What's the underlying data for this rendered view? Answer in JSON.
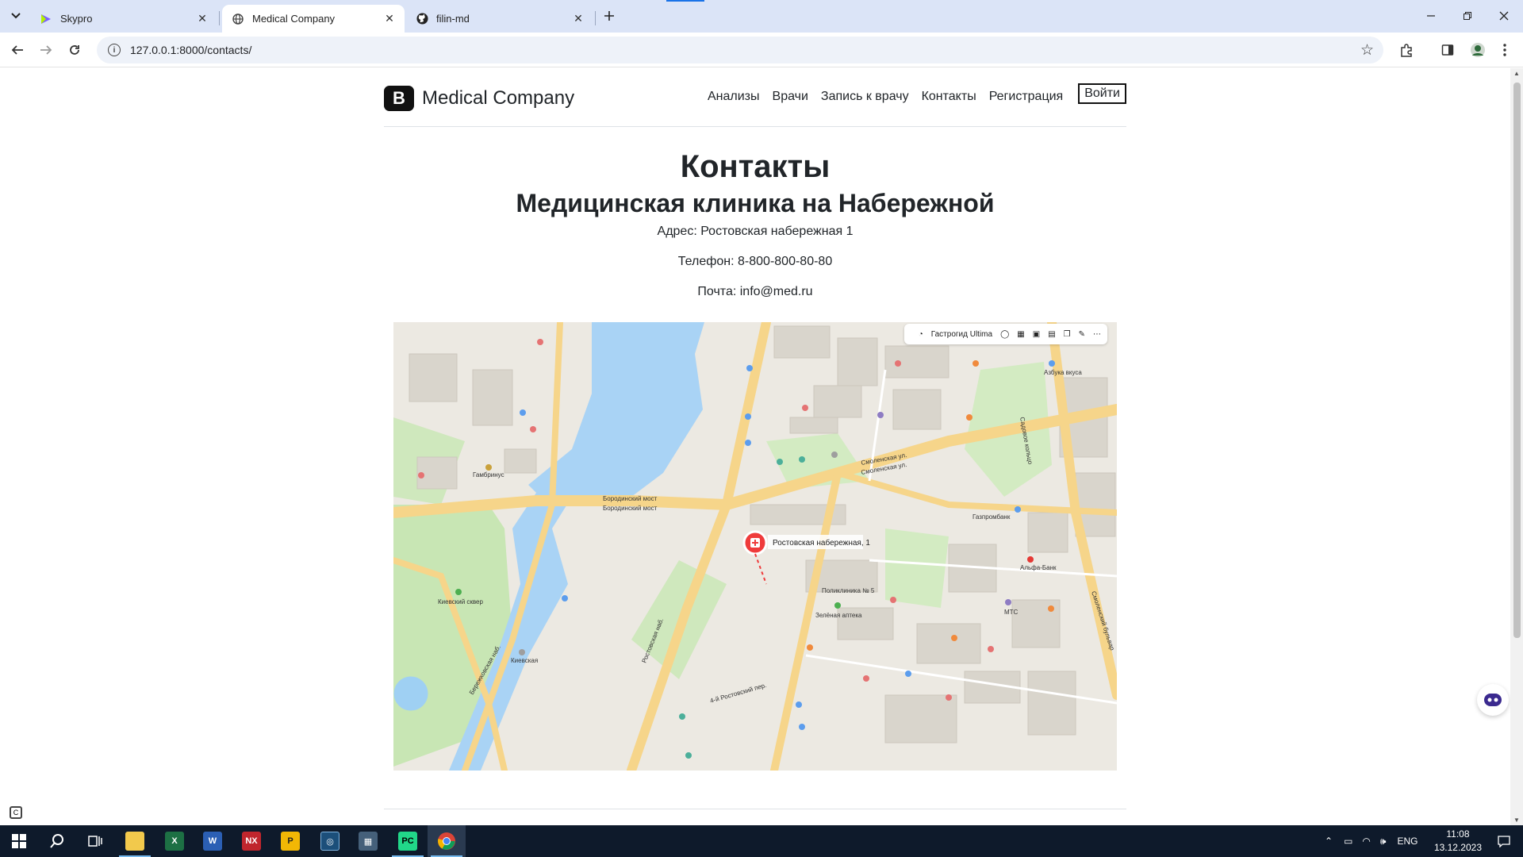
{
  "browser": {
    "tabs": [
      {
        "title": "Skypro",
        "active": false
      },
      {
        "title": "Medical Company",
        "active": true
      },
      {
        "title": "filin-md",
        "active": false
      }
    ],
    "url": "127.0.0.1:8000/contacts/"
  },
  "site": {
    "brand_letter": "B",
    "brand_name": "Medical Company",
    "nav": [
      "Анализы",
      "Врачи",
      "Запись к врачу",
      "Контакты",
      "Регистрация"
    ],
    "login_label": "Войти"
  },
  "contacts": {
    "title": "Контакты",
    "clinic_name": "Медицинская клиника на Набережной",
    "address": "Адрес: Ростовская набережная 1",
    "phone": "Телефон: 8-800-800-80-80",
    "email": "Почта: info@med.ru"
  },
  "map": {
    "toolbar_label": "Гастрогид Ultima",
    "marker_label": "Ростовская набережная, 1",
    "labels": {
      "bridge1": "Бородинский мост",
      "bridge2": "Бородинский мост",
      "smolensk1": "Смоленская ул.",
      "smolensk2": "Смоленская ул.",
      "rost_nab": "Ростовская наб.",
      "rost_per": "4-й Ростовский пер.",
      "kiev_square": "Киевский сквер",
      "kievskaya": "Киевская",
      "berezhk": "Бережковская наб.",
      "sadovoe": "Садовое кольцо",
      "smol_bulv": "Смоленский бульвар",
      "gambrinus": "Гамбринус",
      "azbuka": "Азбука вкуса",
      "alfa": "Альфа-Банк",
      "mts": "МТС",
      "poly": "Поликлиника № 5",
      "gazprom": "Газпромбанк",
      "green_pharm": "Зелёная аптека"
    }
  },
  "taskbar": {
    "time": "11:08",
    "date": "13.12.2023",
    "lang": "ENG"
  },
  "colors": {
    "tabbar": "#dbe4f7",
    "taskbar": "#0e1a2b",
    "river": "#a9d3f5",
    "park": "#c8e6b4",
    "road": "#f6d58a",
    "marker": "#ef3b3b"
  }
}
